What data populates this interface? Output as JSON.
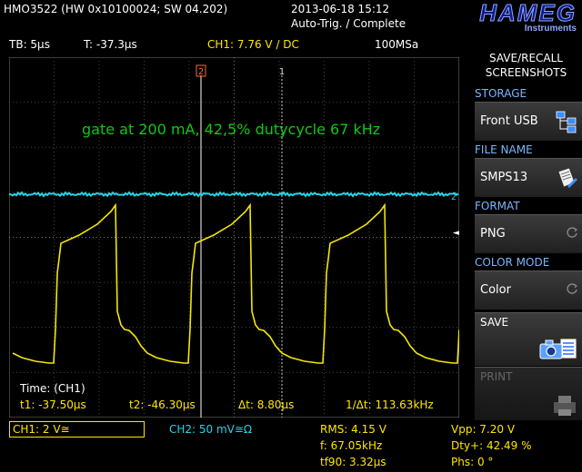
{
  "header": {
    "model": "HMO3522 (HW 0x10100024; SW 04.202)",
    "datetime": "2013-06-18 15:12",
    "trigger_status": "Auto-Trig. / Complete",
    "logo": "HAMEG",
    "logo_sub": "Instruments"
  },
  "status": {
    "timebase": "TB: 5µs",
    "trigger_time": "T: -37.3µs",
    "ch1_trigger": "CH1: 7.76 V / DC",
    "sample_rate": "100MSa"
  },
  "screen": {
    "annotation": "gate at 200 mA, 42,5% dutycycle 67 kHz",
    "cursor2_label": "2",
    "cursor1_label": "1",
    "ch2_marker": "2",
    "ch1_marker": "1",
    "colors": {
      "ch1": "#f4e600",
      "ch2": "#25d6e6",
      "annotation": "#10c810",
      "cursor2": "#ff6a2a",
      "grid": "#555555"
    }
  },
  "cursor_measure": {
    "title": "Time: (CH1)",
    "t1": "t1: -37.50µs",
    "t2": "t2: -46.30µs",
    "dt": "Δt: 8.80µs",
    "inv_dt": "1/Δt: 113.63kHz"
  },
  "bottom": {
    "ch1": "CH1: 2 V≅",
    "ch2": "CH2: 50 mV≅Ω",
    "rms": "RMS: 4.15 V",
    "freq": "f: 67.05kHz",
    "tf90": "tf90: 3.32µs",
    "vpp": "Vpp: 7.20 V",
    "duty": "Dty+: 42.49 %",
    "phase": "Phs: 0 °"
  },
  "menu": {
    "title_line1": "SAVE/RECALL",
    "title_line2": "SCREENSHOTS",
    "storage_label": "STORAGE",
    "storage_value": "Front USB",
    "filename_label": "FILE NAME",
    "filename_value": "SMPS13",
    "format_label": "FORMAT",
    "format_value": "PNG",
    "colormode_label": "COLOR MODE",
    "colormode_value": "Color",
    "save_label": "SAVE",
    "print_label": "PRINT"
  },
  "trace_samples": {
    "ch1_period_us": 14.9,
    "ch1_high_v": 5.0,
    "ch1_low_v": -2.2
  }
}
